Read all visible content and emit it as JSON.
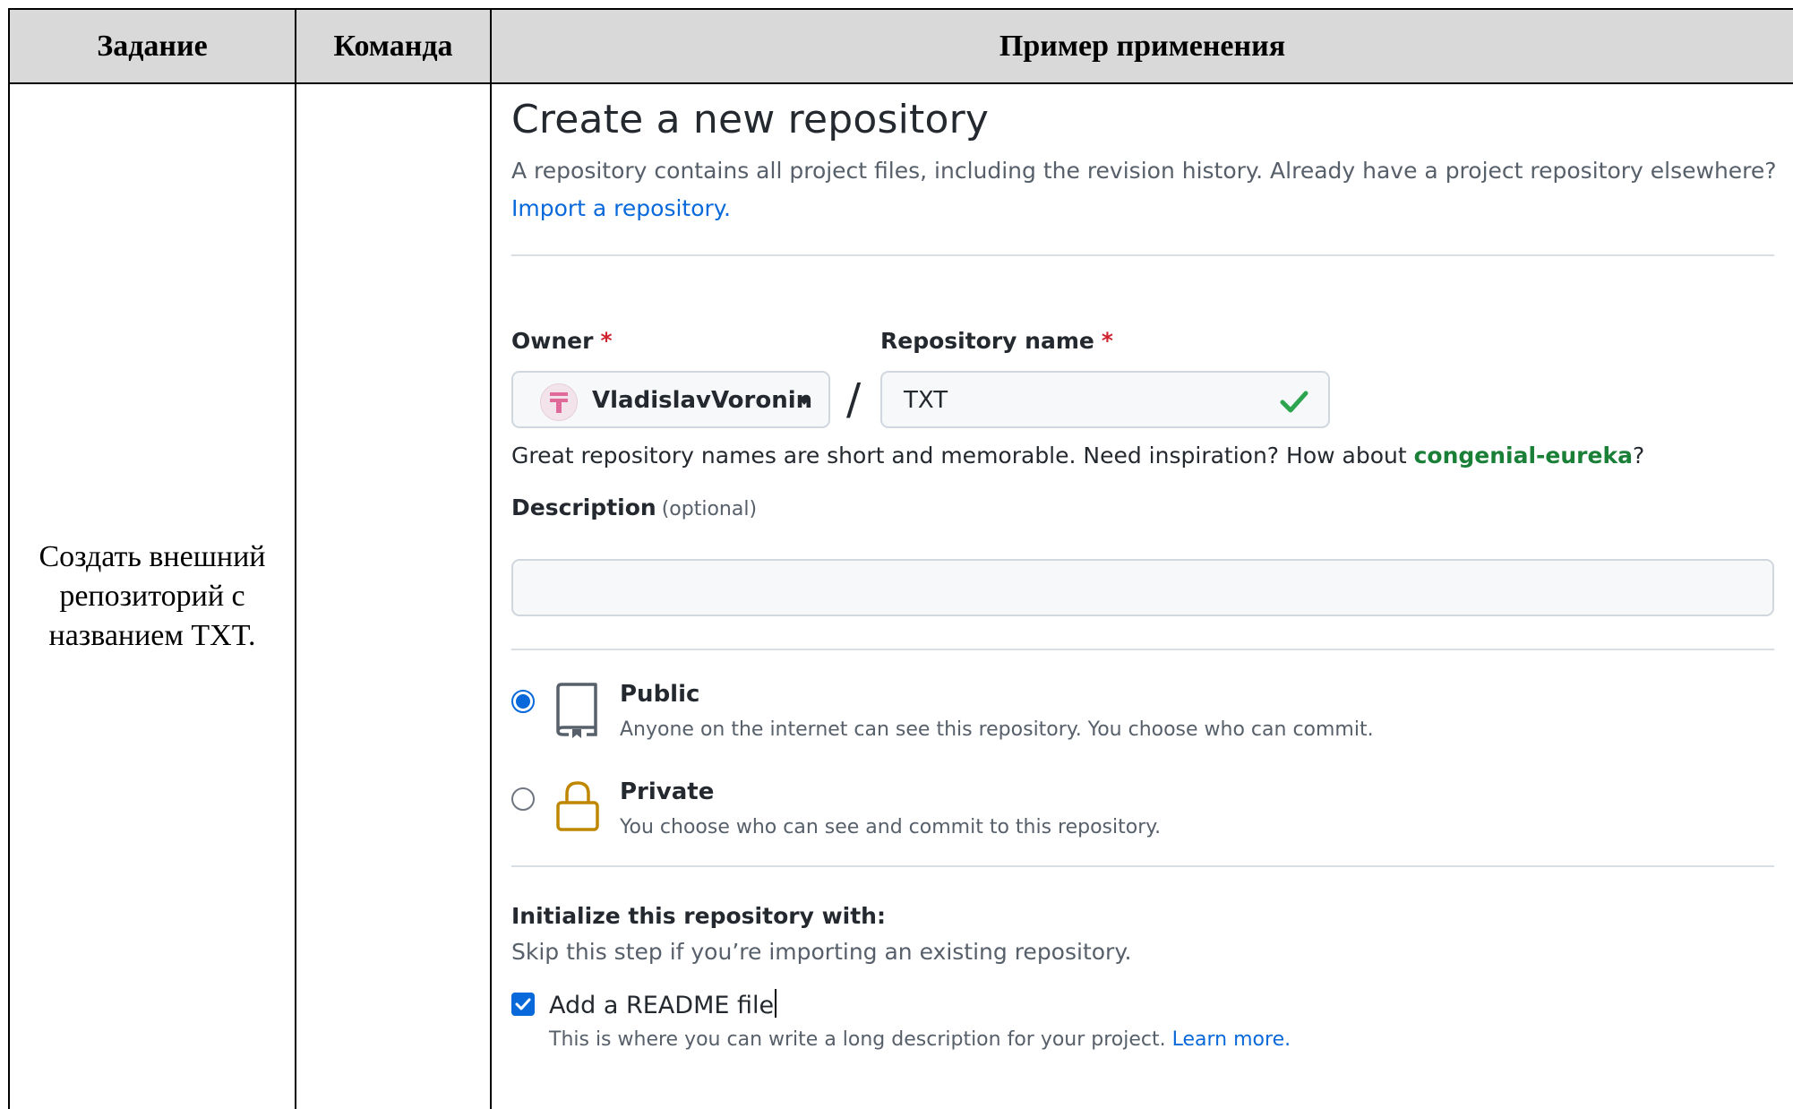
{
  "table": {
    "headers": [
      "Задание",
      "Команда",
      "Пример применения"
    ],
    "task_lines": [
      "Создать внешний",
      "репозиторий с",
      "названием TXT."
    ],
    "command": ""
  },
  "form": {
    "title": "Create a new repository",
    "subtitle": "A repository contains all project files, including the revision history. Already have a project repository elsewhere?",
    "import_link": "Import a repository.",
    "owner_label": "Owner",
    "repo_label": "Repository name",
    "required_mark": "*",
    "owner_value": "VladislavVoronin",
    "slash": "/",
    "repo_value": "TXT",
    "hint_prefix": "Great repository names are short and memorable. Need inspiration? How about ",
    "hint_suggestion": "congenial-eureka",
    "hint_suffix": "?",
    "description_label": "Description",
    "description_optional": "(optional)",
    "description_value": "",
    "visibility": [
      {
        "title": "Public",
        "desc": "Anyone on the internet can see this repository. You choose who can commit.",
        "selected": true,
        "icon": "repo-icon"
      },
      {
        "title": "Private",
        "desc": "You choose who can see and commit to this repository.",
        "selected": false,
        "icon": "lock-icon"
      }
    ],
    "init_title": "Initialize this repository with:",
    "init_sub": "Skip this step if you’re importing an existing repository.",
    "readme_label": "Add a README file",
    "readme_checked": true,
    "readme_desc": "This is where you can write a long description for your project.",
    "learn_more": "Learn more."
  },
  "colors": {
    "header_bg": "#d9d9d9",
    "link": "#0969da",
    "success": "#2da44e",
    "suggestion": "#1a7f37",
    "required": "#cf222e",
    "lock_icon": "#bf8700"
  }
}
